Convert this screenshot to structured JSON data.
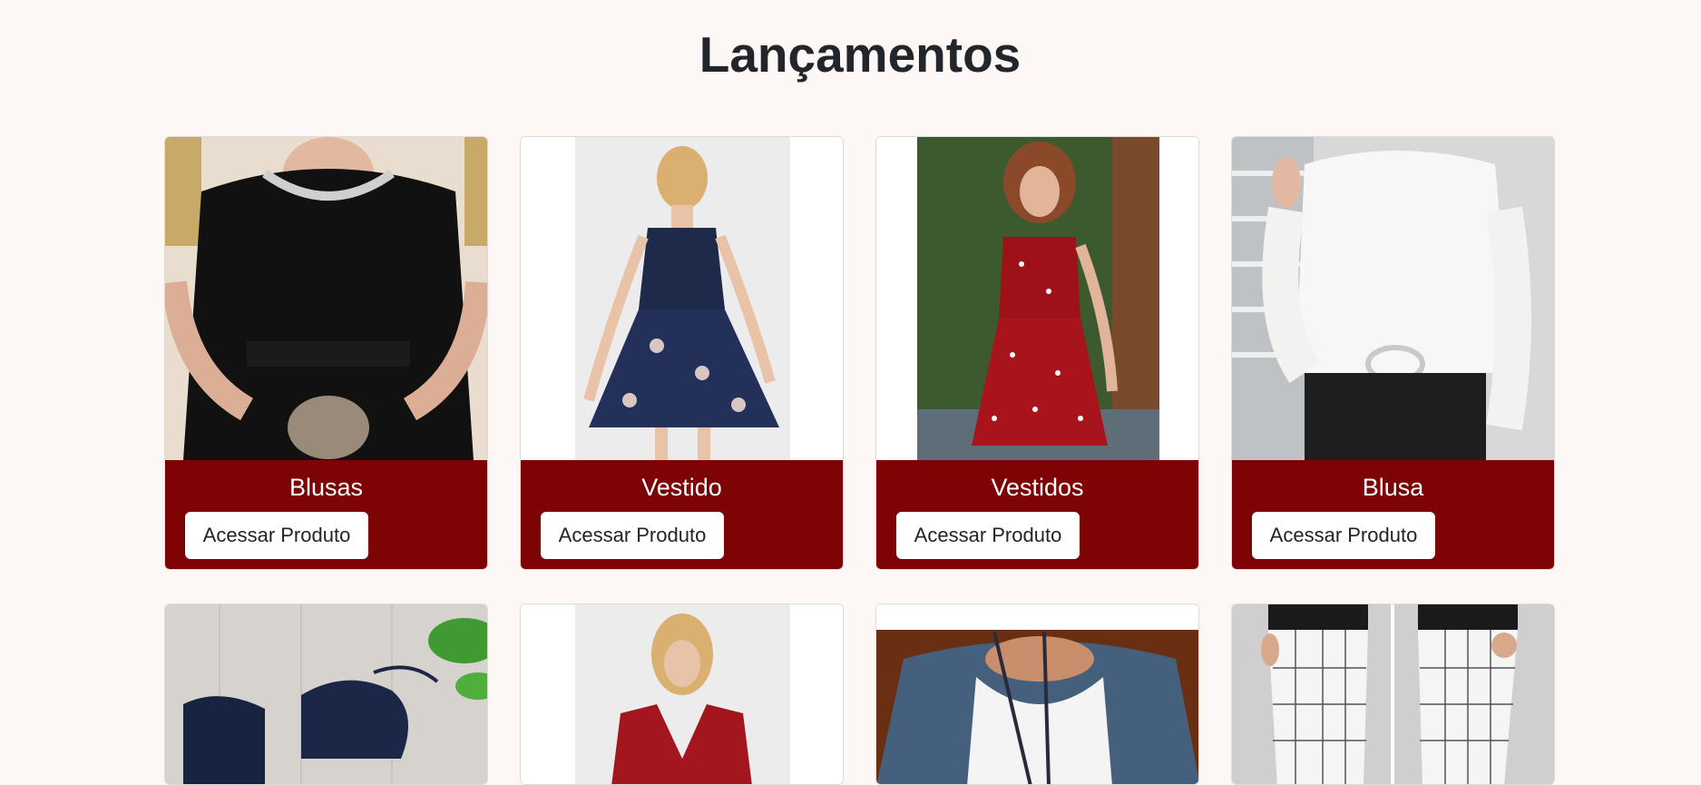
{
  "page": {
    "title": "Lançamentos"
  },
  "products_row1": [
    {
      "name": "Blusas",
      "button": "Acessar Produto"
    },
    {
      "name": "Vestido",
      "button": "Acessar Produto"
    },
    {
      "name": "Vestidos",
      "button": "Acessar Produto"
    },
    {
      "name": "Blusa",
      "button": "Acessar Produto"
    }
  ],
  "colors": {
    "card_footer": "#7d0305",
    "background": "#fdf7f6"
  }
}
